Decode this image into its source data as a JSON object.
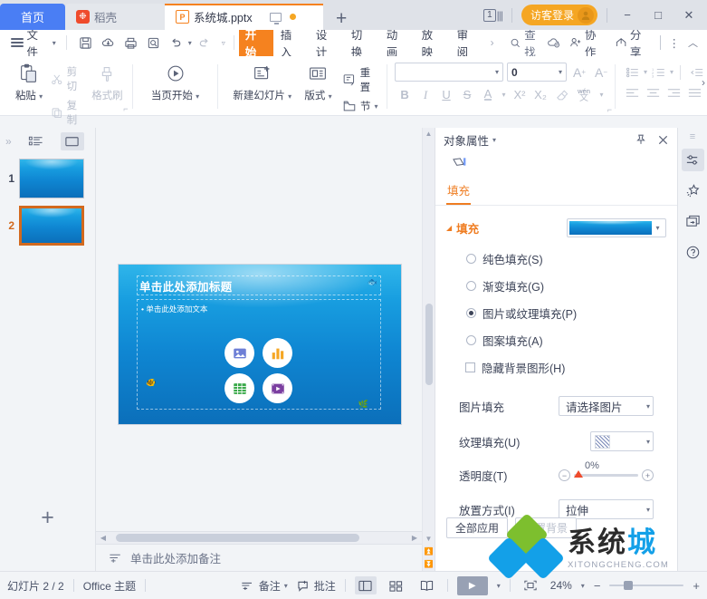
{
  "window": {
    "tabs": [
      {
        "label": "首页",
        "icon": "home-icon",
        "type": "home"
      },
      {
        "label": "稻壳",
        "icon": "docer-icon",
        "type": "docer"
      },
      {
        "label": "系统城.pptx",
        "icon": "ppt-file-icon",
        "type": "document",
        "active": true
      }
    ],
    "new_tab_label": "+",
    "page_count_badge": "1",
    "login_label": "访客登录",
    "minimize": "−",
    "maximize": "□",
    "close": "✕"
  },
  "menubar": {
    "file_label": "文件",
    "quick_icons": [
      "save-icon",
      "cloud-save-icon",
      "print-icon",
      "print-preview-icon",
      "undo-icon",
      "redo-icon",
      "customize-qat-icon"
    ],
    "ribbon_tabs": [
      "开始",
      "插入",
      "设计",
      "切换",
      "动画",
      "放映",
      "审阅"
    ],
    "selected_ribbon_tab": "开始",
    "more_tabs": "›",
    "find_label": "查找",
    "right_items": [
      {
        "label": "",
        "icon": "cloud-sync-icon"
      },
      {
        "label": "协作",
        "icon": "collaborate-icon"
      },
      {
        "label": "分享",
        "icon": "share-icon"
      }
    ],
    "overflow": "⋮",
    "collapse": "︿"
  },
  "ribbon": {
    "clipboard": {
      "paste_label": "粘贴",
      "cut_label": "剪切",
      "copy_label": "复制",
      "format_painter_label": "格式刷"
    },
    "slideshow": {
      "from_current_label": "当页开始"
    },
    "slides": {
      "new_slide_label": "新建幻灯片",
      "layout_label": "版式",
      "reset_label": "重置",
      "section_label": "节"
    },
    "font": {
      "font_name_value": "",
      "font_size_value": "0",
      "increase_size": "A⁺",
      "decrease_size": "A⁻",
      "bold": "B",
      "italic": "I",
      "underline": "U",
      "strikethrough": "S",
      "font_color": "A",
      "superscript": "X²",
      "subscript": "X₂",
      "clear_format": "clear-format-icon",
      "phonetic": "wén"
    },
    "paragraph": {
      "bullets": "bullet-list-icon",
      "numbering": "numbered-list-icon",
      "decrease_indent": "decrease-indent-icon",
      "align_left": "align-left-icon",
      "align_center": "align-center-icon",
      "align_right": "align-right-icon",
      "align_justify": "align-justify-icon"
    },
    "expand": "›"
  },
  "thumbnails": {
    "collapse_label": "»",
    "view_outline": "outline-view-icon",
    "view_slides": "slide-view-icon",
    "slides": [
      {
        "number": "1",
        "selected": false
      },
      {
        "number": "2",
        "selected": true
      }
    ],
    "add_slide_label": "+"
  },
  "slide": {
    "title_placeholder": "单击此处添加标题",
    "body_placeholder": "单击此处添加文本",
    "content_icons": [
      "picture-icon",
      "chart-icon",
      "table-icon",
      "media-icon"
    ]
  },
  "notes": {
    "placeholder": "单击此处添加备注",
    "icon": "notes-icon"
  },
  "panel": {
    "title": "对象属性",
    "pin_icon": "pin-icon",
    "close_icon": "close-icon",
    "shape_icon": "shape-icon",
    "tab_label": "填充",
    "section_title": "填充",
    "fill_preview_label": "picture-fill-preview",
    "options": [
      {
        "label": "纯色填充(S)",
        "type": "radio",
        "selected": false
      },
      {
        "label": "渐变填充(G)",
        "type": "radio",
        "selected": false
      },
      {
        "label": "图片或纹理填充(P)",
        "type": "radio",
        "selected": true
      },
      {
        "label": "图案填充(A)",
        "type": "radio",
        "selected": false
      },
      {
        "label": "隐藏背景图形(H)",
        "type": "checkbox",
        "selected": false
      }
    ],
    "rows": [
      {
        "label": "图片填充",
        "value": "请选择图片",
        "control": "combo"
      },
      {
        "label": "纹理填充(U)",
        "value": "",
        "control": "texture-combo"
      },
      {
        "label": "透明度(T)",
        "value": "0%",
        "control": "slider"
      },
      {
        "label": "放置方式(I)",
        "value": "拉伸",
        "control": "combo"
      }
    ],
    "apply_all_label": "全部应用",
    "reset_bg_label": "重置背景",
    "rail_icons": [
      "properties-icon",
      "animation-icon",
      "selection-pane-icon",
      "help-icon"
    ]
  },
  "status": {
    "slide_count": "幻灯片 2 / 2",
    "theme": "Office 主题",
    "notes_label": "备注",
    "comment_label": "批注",
    "view_icons": [
      "normal-view-icon",
      "slide-sorter-icon",
      "reading-view-icon"
    ],
    "play_label": "▶",
    "fit_icon": "fit-to-window-icon",
    "zoom_value": "24%",
    "zoom_out": "−",
    "zoom_in": "+"
  },
  "watermark": {
    "text_cn_1": "系统",
    "text_cn_2": "城",
    "text_en": "XITONGCHENG.COM",
    "color_dark": "#2b2b2b",
    "color_blue": "#13a0e8",
    "color_green": "#7dbf2e"
  }
}
